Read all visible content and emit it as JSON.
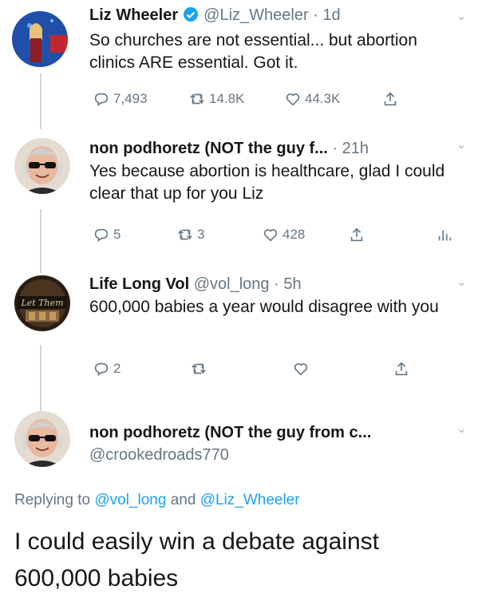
{
  "tweets": [
    {
      "name": "Liz Wheeler",
      "handle": "@Liz_Wheeler",
      "time": "· 1d",
      "text": "So churches are not essential... but abortion clinics ARE essential. Got it.",
      "replies": "7,493",
      "retweets": "14.8K",
      "likes": "44.3K"
    },
    {
      "name": "non podhoretz (NOT the guy f...",
      "time": "· 21h",
      "text": "Yes because abortion is healthcare, glad I could clear that up for you Liz",
      "replies": "5",
      "retweets": "3",
      "likes": "428"
    },
    {
      "name": "Life Long Vol",
      "handle": "@vol_long",
      "time": "· 5h",
      "text": "600,000 babies a year would disagree with you",
      "replies": "2"
    }
  ],
  "focused": {
    "name": "non podhoretz (NOT the guy from c...",
    "handle": "@crookedroads770",
    "replying_prefix": "Replying to",
    "reply_user1": "@vol_long",
    "and": "and",
    "reply_user2": "@Liz_Wheeler",
    "text": "I could easily win a debate against 600,000 babies"
  },
  "icons": {
    "reply": "reply-icon",
    "retweet": "retweet-icon",
    "like": "heart-icon",
    "share": "share-icon",
    "analytics": "analytics-icon",
    "verified": "verified-badge-icon",
    "menu": "chevron-down-icon"
  },
  "colors": {
    "link": "#1da1f2",
    "muted": "#657786",
    "text": "#14171a",
    "verified": "#1da1f2"
  }
}
